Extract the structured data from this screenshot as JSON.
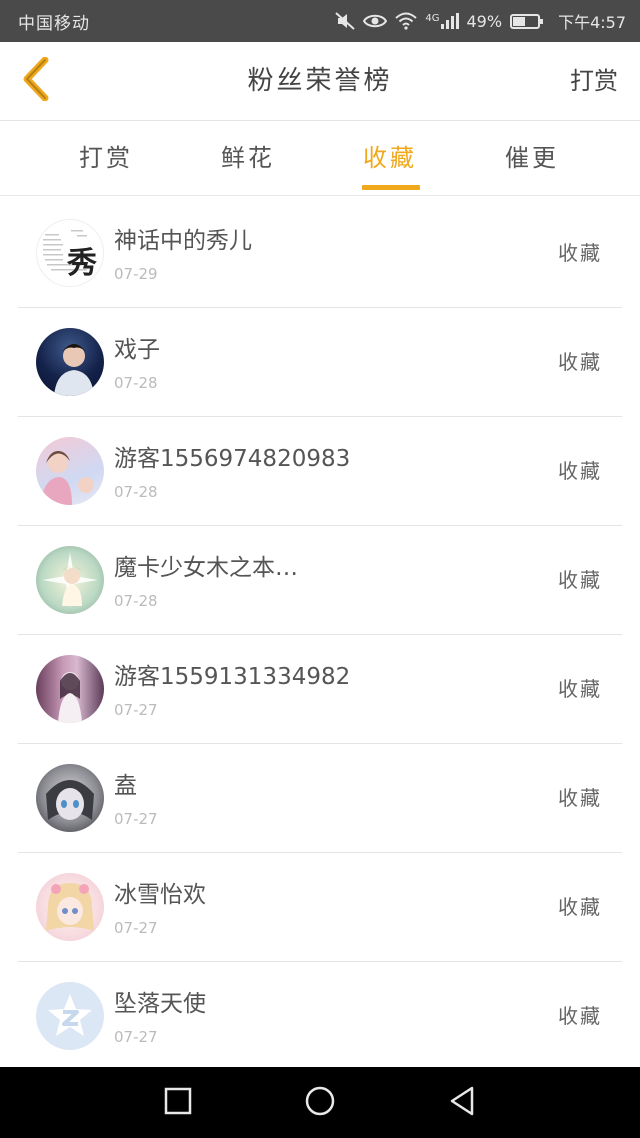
{
  "status_bar": {
    "carrier": "中国移动",
    "network": "4G",
    "battery": "49%",
    "battery_level": 0.49,
    "time": "下午4:57"
  },
  "header": {
    "title": "粉丝荣誉榜",
    "action_label": "打赏"
  },
  "tabs": [
    {
      "label": "打赏",
      "active": false
    },
    {
      "label": "鲜花",
      "active": false
    },
    {
      "label": "收藏",
      "active": true
    },
    {
      "label": "催更",
      "active": false
    }
  ],
  "list": [
    {
      "name": "神话中的秀儿",
      "date": "07-29",
      "action": "收藏",
      "avatar_text": "秀"
    },
    {
      "name": "戏子",
      "date": "07-28",
      "action": "收藏"
    },
    {
      "name": "游客1556974820983",
      "date": "07-28",
      "action": "收藏"
    },
    {
      "name": "魔卡少女木之本…",
      "date": "07-28",
      "action": "收藏"
    },
    {
      "name": "游客1559131334982",
      "date": "07-27",
      "action": "收藏"
    },
    {
      "name": "盍",
      "date": "07-27",
      "action": "收藏"
    },
    {
      "name": "冰雪怡欢",
      "date": "07-27",
      "action": "收藏"
    },
    {
      "name": "坠落天使",
      "date": "07-27",
      "action": "收藏"
    }
  ],
  "colors": {
    "accent": "#f0a81c",
    "status_bar": "#4a4a4a",
    "nav_bar": "#000000"
  }
}
